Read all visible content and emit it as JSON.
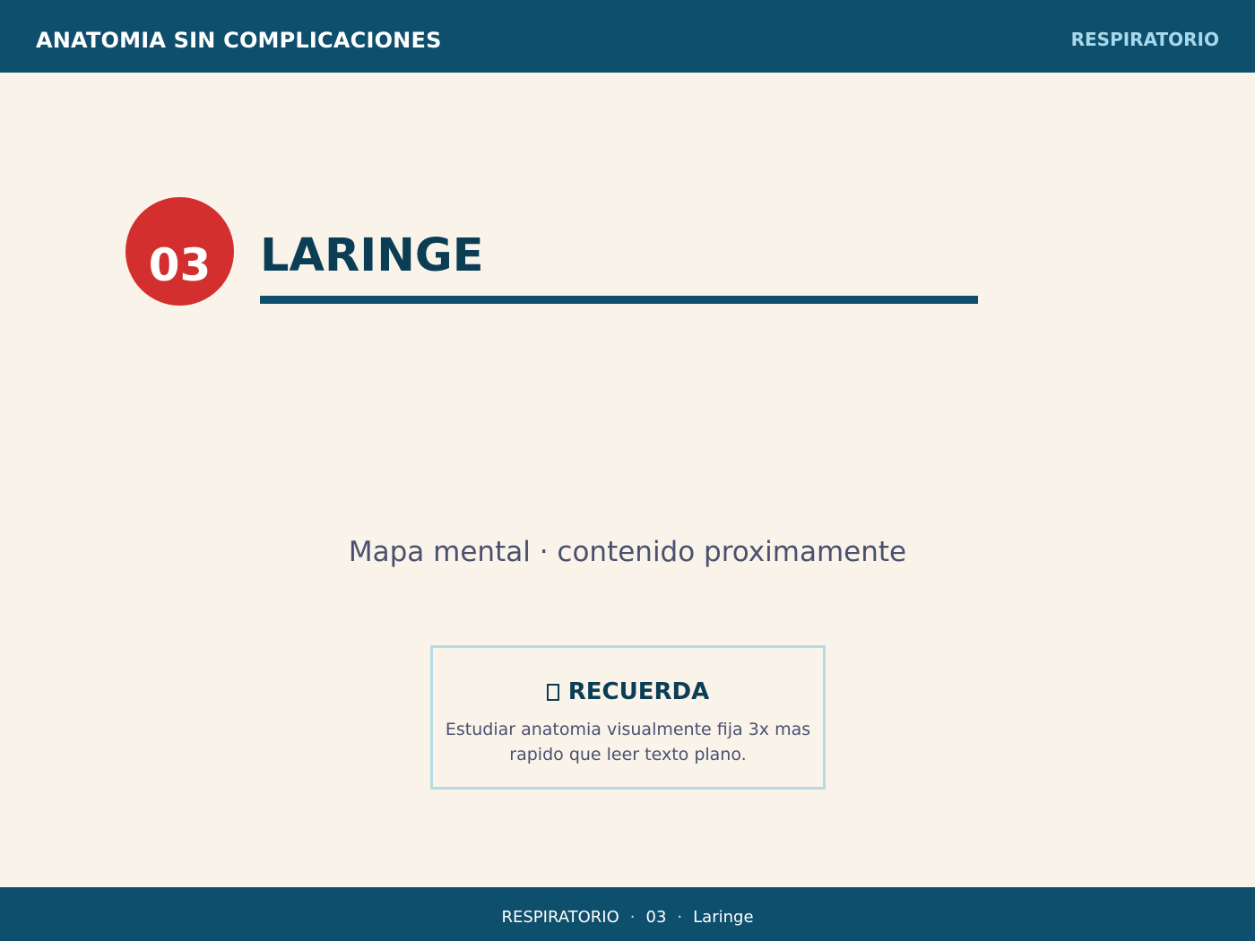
{
  "header": {
    "brand": "ANATOMIA SIN COMPLICACIONES",
    "section": "RESPIRATORIO"
  },
  "topic": {
    "number": "03",
    "title": "LARINGE"
  },
  "main": {
    "placeholder": "Mapa mental · contenido proximamente"
  },
  "remember": {
    "icon": "pin-icon",
    "label": "RECUERDA",
    "text": "Estudiar anatomia visualmente fija 3x mas rapido que leer texto plano."
  },
  "footer": {
    "section": "RESPIRATORIO",
    "separator": "·",
    "number": "03",
    "topic": "Laringe"
  },
  "colors": {
    "background": "#faf3e9",
    "bar": "#0d4f6c",
    "accent_red": "#d32f2f",
    "title": "#0b3d55",
    "section_tag": "#a8d8ea",
    "box_border": "#b6dae6"
  }
}
